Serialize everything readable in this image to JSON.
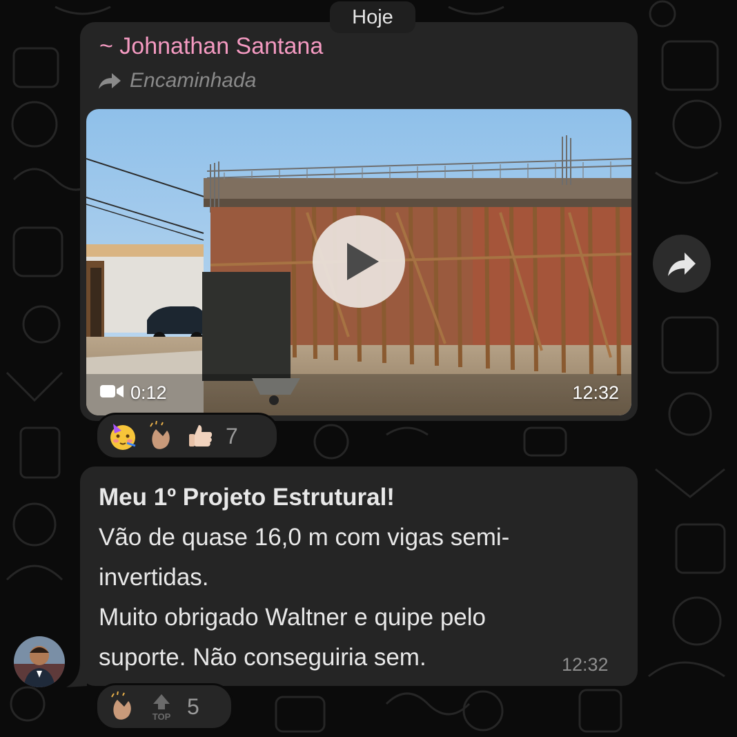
{
  "header": {
    "date_chip": "Hoje"
  },
  "message1": {
    "sender_name": "~ Johnathan Santana",
    "forwarded_label": "Encaminhada",
    "video": {
      "duration": "0:12",
      "timestamp": "12:32",
      "icon": "play-icon"
    },
    "reactions": {
      "emojis": [
        "partying-face",
        "clapping-hands",
        "thumbs-up"
      ],
      "count": "7"
    }
  },
  "message2": {
    "lines": [
      "Meu 1º Projeto Estrutural!",
      "Vão de quase 16,0 m com vigas semi-",
      "invertidas.",
      "Muito obrigado Waltner e quipe pelo",
      "suporte. Não conseguiria sem."
    ],
    "timestamp": "12:32",
    "reactions": {
      "emojis": [
        "clapping-hands",
        "top-arrow"
      ],
      "top_label": "TOP",
      "count": "5"
    }
  },
  "colors": {
    "background": "#0b0b0b",
    "bubble": "#252525",
    "sender_name": "#f49ac1",
    "secondary_text": "#8a8a8a"
  }
}
